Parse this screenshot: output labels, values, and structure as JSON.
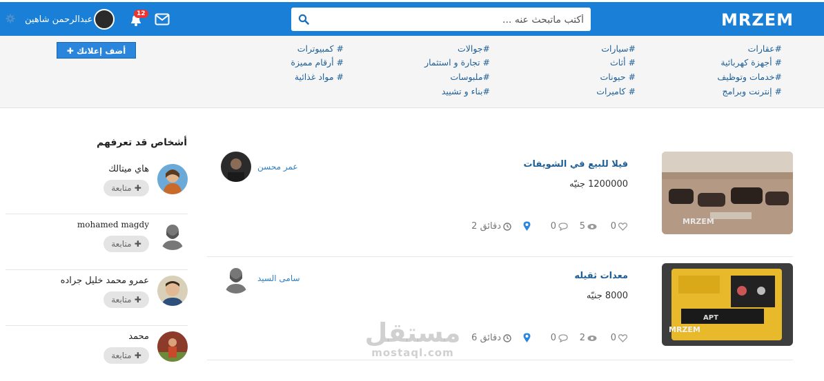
{
  "header": {
    "logo": "MRZEM",
    "search_placeholder": "أكتب ماتبحث عنه ...",
    "user_name": "عبدالرحمن شاهين",
    "notification_count": "12"
  },
  "categories": {
    "items": [
      "#عقارات",
      "# أجهزة كهربائية",
      "#خدمات وتوظيف",
      "# إنترنت وبرامج",
      "#سيارات",
      "# أثاث",
      "# حيونات",
      "# كاميرات",
      "#جوالات",
      "# تجارة و استثمار",
      "#ملبوسات",
      "#بناء و تشييد",
      "# كمبيوترات",
      "# أرقام مميزة",
      "# مواد غذائية"
    ],
    "add_ad_label": "أضف إعلانك"
  },
  "posts": [
    {
      "title": "فيلا للبيع في الشويفات",
      "price": "1200000 جنيّه",
      "seller": "عمر محسن",
      "likes": "0",
      "views": "5",
      "comments": "0",
      "time": "2 دقائق",
      "image_watermark": "MRZEM"
    },
    {
      "title": "معدات ثقيله",
      "price": "8000 جنيّه",
      "seller": "سامى السيد",
      "likes": "0",
      "views": "2",
      "comments": "0",
      "time": "6 دقائق",
      "image_watermark": "MRZEM"
    }
  ],
  "sidebar": {
    "title": "أشخاص قد تعرفهم",
    "follow_label": "متابعة",
    "people": [
      {
        "name": "هاي ميتالك"
      },
      {
        "name": "mohamed magdy"
      },
      {
        "name": "عمرو محمد خليل جراده"
      },
      {
        "name": "محمد"
      }
    ]
  },
  "watermark": {
    "arabic": "مستقل",
    "latin": "mostaql.com"
  },
  "colors": {
    "primary": "#1a7fd6",
    "link": "#1f5f96",
    "badge": "#e33333"
  }
}
